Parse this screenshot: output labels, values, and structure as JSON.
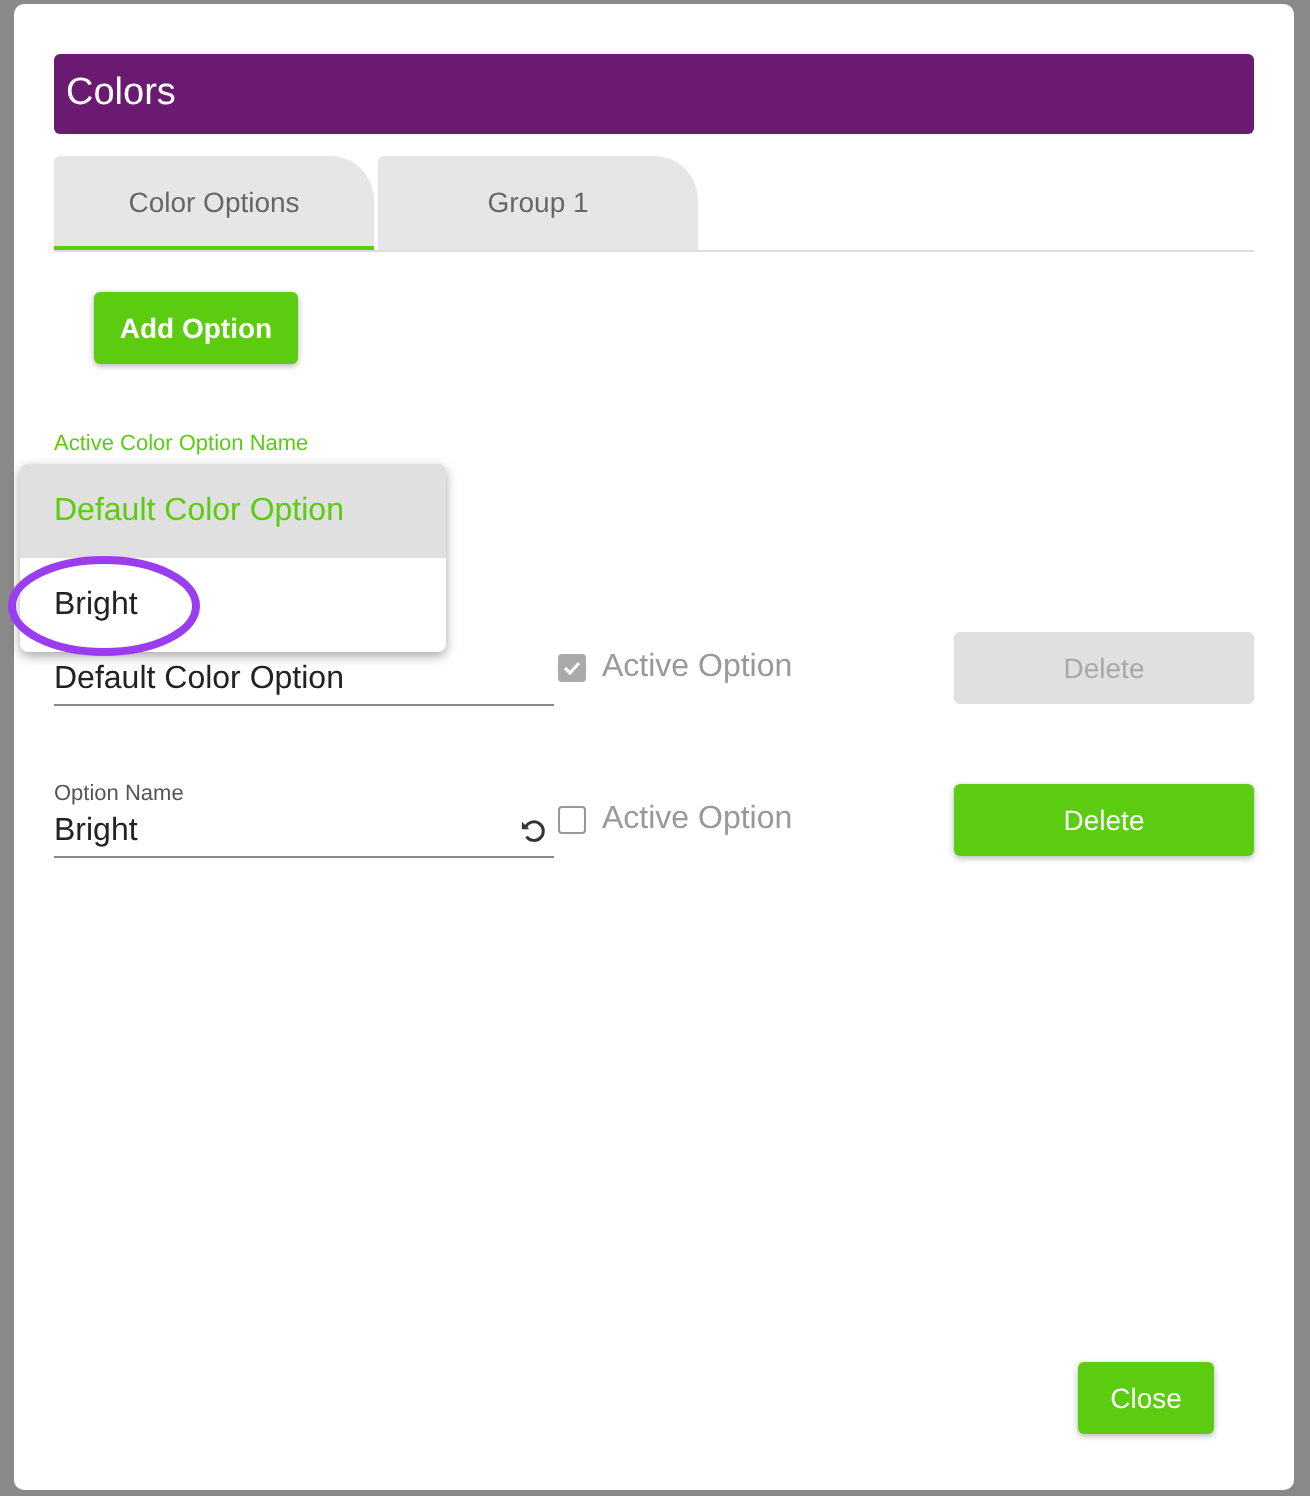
{
  "dialog": {
    "title": "Colors"
  },
  "tabs": [
    {
      "label": "Color Options",
      "selected": true
    },
    {
      "label": "Group 1",
      "selected": false
    }
  ],
  "add_button": "Add Option",
  "active_select": {
    "label": "Active Color Option Name"
  },
  "dropdown": [
    {
      "label": "Default Color Option",
      "selected": true,
      "circled": false
    },
    {
      "label": "Bright",
      "selected": false,
      "circled": true
    }
  ],
  "options": [
    {
      "value": "Default Color Option",
      "checkbox_label": "Active Option",
      "checked": true,
      "delete_label": "Delete",
      "disabled": true,
      "undo": false
    },
    {
      "label": "Option Name",
      "value": "Bright",
      "checkbox_label": "Active Option",
      "checked": false,
      "delete_label": "Delete",
      "disabled": false,
      "undo": true
    }
  ],
  "close_button": "Close"
}
